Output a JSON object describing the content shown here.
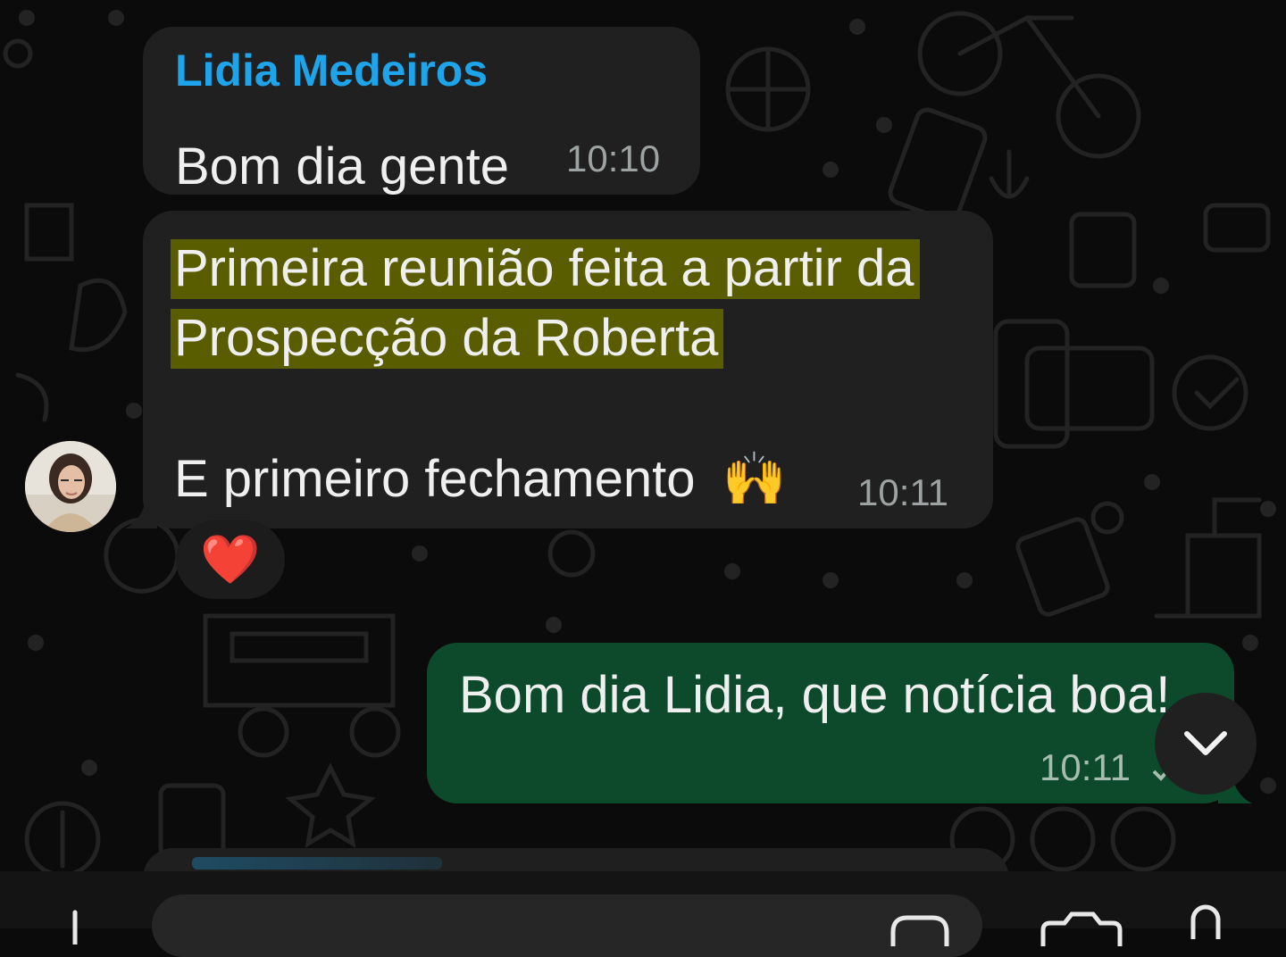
{
  "messages": [
    {
      "sender": "Lidia Medeiros",
      "text": "Bom dia gente",
      "time": "10:10"
    },
    {
      "lines": [
        "Primeira reunião feita a partir da",
        "Prospecção da Roberta"
      ],
      "line3": "E primeiro fechamento",
      "emoji": "🙌",
      "time": "10:11",
      "reaction": "❤️"
    },
    {
      "text": "Bom dia Lidia, que notícia boa!",
      "time": "10:11"
    }
  ],
  "icons": {
    "scroll_down": "chevron-down-icon",
    "avatar": "avatar",
    "input_icons": [
      "plus-icon",
      "sticker-icon",
      "camera-icon",
      "microphone-icon"
    ]
  },
  "colors": {
    "sender_name": "#1ea4ea",
    "incoming_bubble": "#202020",
    "outgoing_bubble": "#0d4a2c",
    "highlight": "#5a5c00"
  }
}
